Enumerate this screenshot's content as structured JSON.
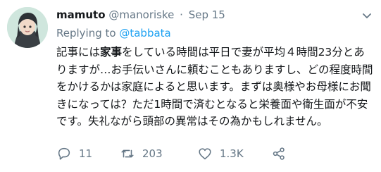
{
  "tweet": {
    "display_name": "mamuto",
    "handle": "@manoriske",
    "separator": "·",
    "timestamp": "Sep 15",
    "replying_prefix": "Replying to ",
    "replying_to": "@tabbata",
    "body_part1": "記事には",
    "body_bold": "家事",
    "body_part2": "をしている時間は平日で妻が平均４時間23分とありますが…お手伝いさんに頼むこともありますし、どの程度時間をかけるかは家庭によると思います。まずは奥様やお母様にお聞きになっては？ただ1時間で済むとなると栄養面や衛生面が不安です。失礼ながら頭部の異常はその為かもしれません。"
  },
  "actions": {
    "reply_count": "11",
    "retweet_count": "203",
    "like_count": "1.3K"
  },
  "icons": {
    "caret": "chevron-down-icon",
    "reply": "reply-icon",
    "retweet": "retweet-icon",
    "like": "heart-icon",
    "share": "share-icon"
  },
  "colors": {
    "link": "#1da1f2",
    "muted": "#657786",
    "text": "#14171a"
  }
}
